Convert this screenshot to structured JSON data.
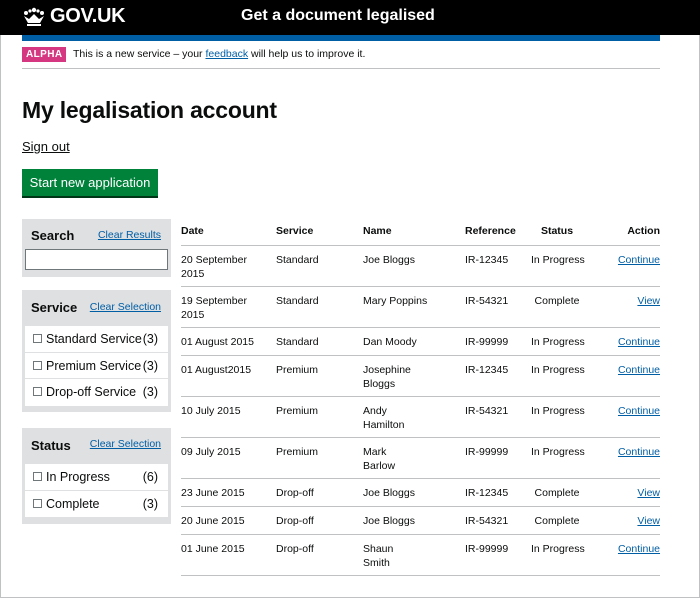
{
  "header": {
    "logo_text": "GOV.UK",
    "service_name": "Get a document legalised"
  },
  "phase_banner": {
    "tag": "ALPHA",
    "text_before": "This is a new service – your ",
    "link": "feedback",
    "text_after": " will help us to improve it."
  },
  "page": {
    "title": "My legalisation account",
    "sign_out": "Sign out",
    "start_button": "Start new application"
  },
  "filters": {
    "search": {
      "title": "Search",
      "clear": "Clear Results",
      "value": ""
    },
    "service": {
      "title": "Service",
      "clear": "Clear Selection",
      "options": [
        {
          "label": "Standard Service",
          "count": "(3)"
        },
        {
          "label": "Premium Service",
          "count": "(3)"
        },
        {
          "label": "Drop-off Service",
          "count": "(3)"
        }
      ]
    },
    "status": {
      "title": "Status",
      "clear": "Clear Selection",
      "options": [
        {
          "label": "In Progress",
          "count": "(6)"
        },
        {
          "label": "Complete",
          "count": "(3)"
        }
      ]
    }
  },
  "table": {
    "headers": {
      "date": "Date",
      "service": "Service",
      "name": "Name",
      "reference": "Reference",
      "status": "Status",
      "action": "Action"
    },
    "rows": [
      {
        "date": "20 September 2015",
        "service": "Standard",
        "name": "Joe Bloggs",
        "reference": "IR-12345",
        "status": "In Progress",
        "action": "Continue"
      },
      {
        "date": "19 September 2015",
        "service": "Standard",
        "name": "Mary Poppins",
        "reference": "IR-54321",
        "status": "Complete",
        "action": "View"
      },
      {
        "date": "01 August 2015",
        "service": "Standard",
        "name": "Dan Moody",
        "reference": "IR-99999",
        "status": "In Progress",
        "action": "Continue"
      },
      {
        "date": "01 August2015",
        "service": "Premium",
        "name": "Josephine Bloggs",
        "reference": "IR-12345",
        "status": "In Progress",
        "action": "Continue"
      },
      {
        "date": "10 July 2015",
        "service": "Premium",
        "name": "Andy Hamilton",
        "reference": "IR-54321",
        "status": "In Progress",
        "action": "Continue"
      },
      {
        "date": "09 July 2015",
        "service": "Premium",
        "name": "Mark Barlow",
        "reference": "IR-99999",
        "status": "In Progress",
        "action": "Continue"
      },
      {
        "date": "23 June 2015",
        "service": "Drop-off",
        "name": "Joe Bloggs",
        "reference": "IR-12345",
        "status": "Complete",
        "action": "View"
      },
      {
        "date": "20 June 2015",
        "service": "Drop-off",
        "name": "Joe Bloggs",
        "reference": "IR-54321",
        "status": "Complete",
        "action": "View"
      },
      {
        "date": "01 June 2015",
        "service": "Drop-off",
        "name": "Shaun Smith",
        "reference": "IR-99999",
        "status": "In Progress",
        "action": "Continue"
      }
    ]
  }
}
